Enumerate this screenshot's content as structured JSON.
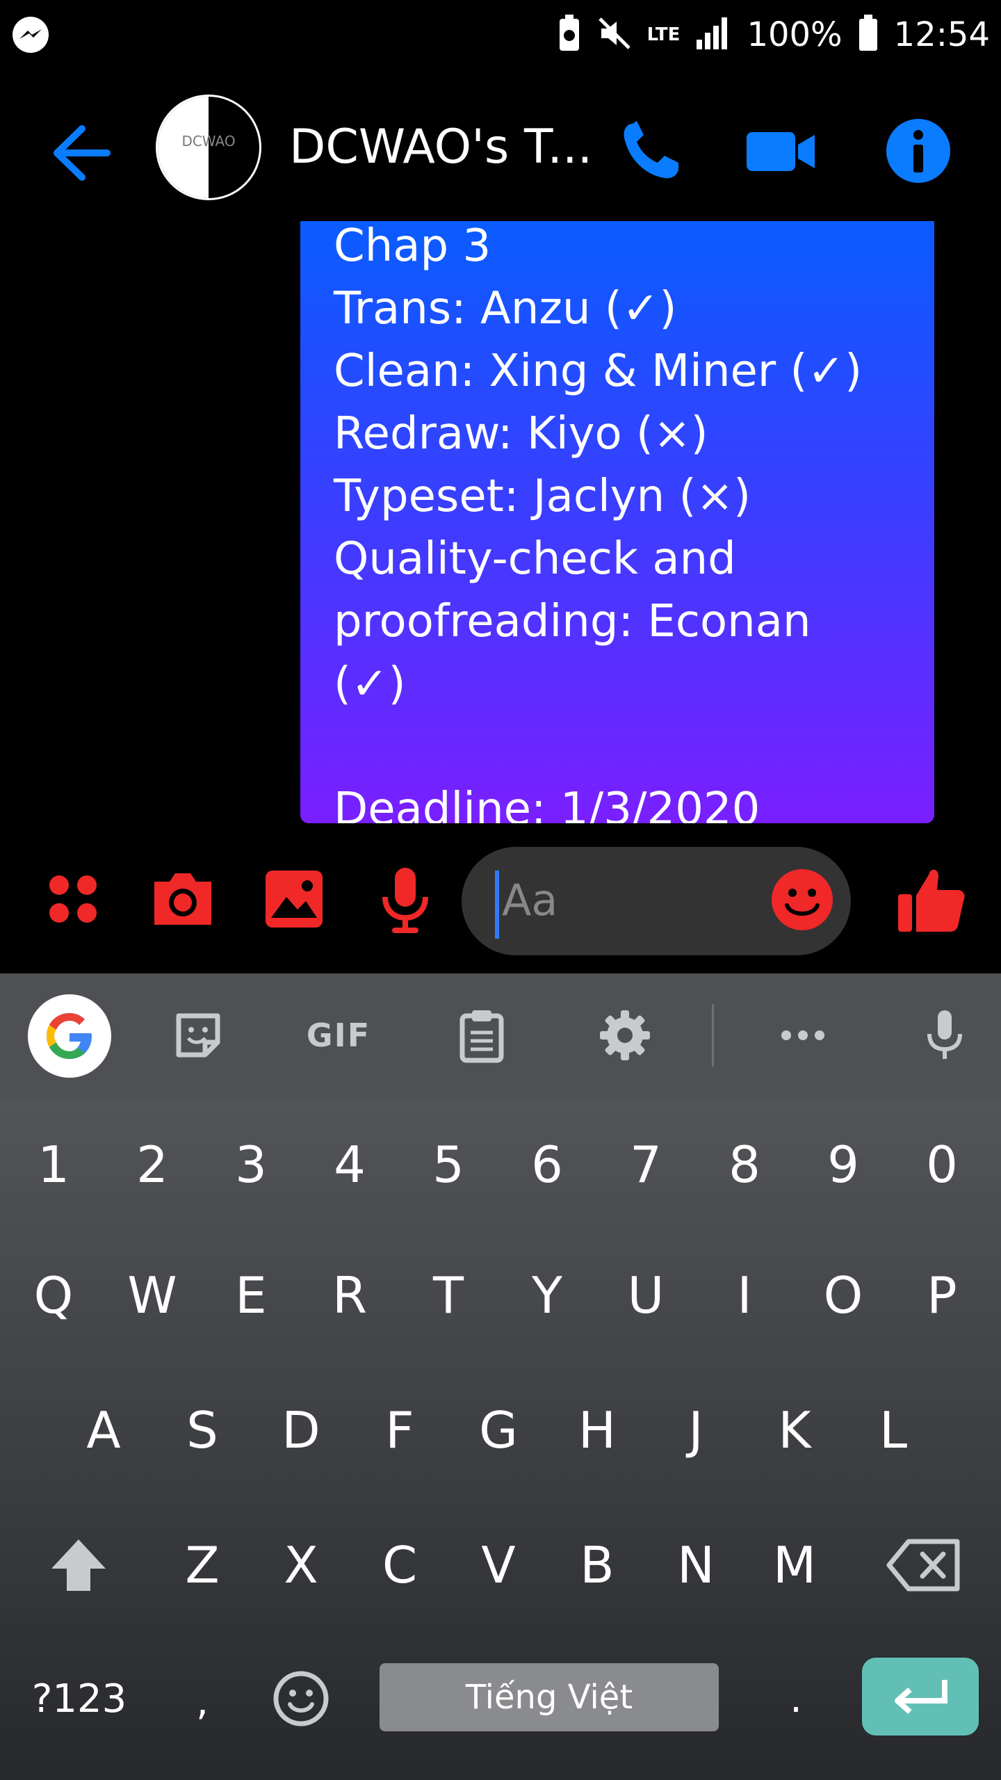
{
  "status_bar": {
    "battery_percent": "100%",
    "time": "12:54",
    "network": "LTE"
  },
  "header": {
    "title": "DCWAO's T...",
    "avatar_text": "DCWAO"
  },
  "message": {
    "lines": [
      "Chap 3",
      "Trans: Anzu (✓)",
      "Clean: Xing & Miner (✓)",
      "Redraw: Kiyo (×)",
      "Typeset: Jaclyn (×)",
      "Quality-check and",
      "proofreading: Econan",
      "(✓)",
      "",
      "Deadline: 1/3/2020"
    ]
  },
  "composer": {
    "placeholder": "Aa"
  },
  "keyboard": {
    "toolbar": {
      "gif_label": "GIF"
    },
    "number_row": [
      "1",
      "2",
      "3",
      "4",
      "5",
      "6",
      "7",
      "8",
      "9",
      "0"
    ],
    "row1": [
      "Q",
      "W",
      "E",
      "R",
      "T",
      "Y",
      "U",
      "I",
      "O",
      "P"
    ],
    "row2": [
      "A",
      "S",
      "D",
      "F",
      "G",
      "H",
      "J",
      "K",
      "L"
    ],
    "row3": [
      "Z",
      "X",
      "C",
      "V",
      "B",
      "N",
      "M"
    ],
    "bottom": {
      "symbols": "?123",
      "comma": ",",
      "space": "Tiếng Việt",
      "period": "."
    }
  },
  "colors": {
    "messenger_blue": "#0a7cff",
    "composer_red": "#f02828",
    "bubble_top": "#0a5cff",
    "bubble_bottom": "#7a1fff",
    "enter_key": "#62bfb6"
  }
}
